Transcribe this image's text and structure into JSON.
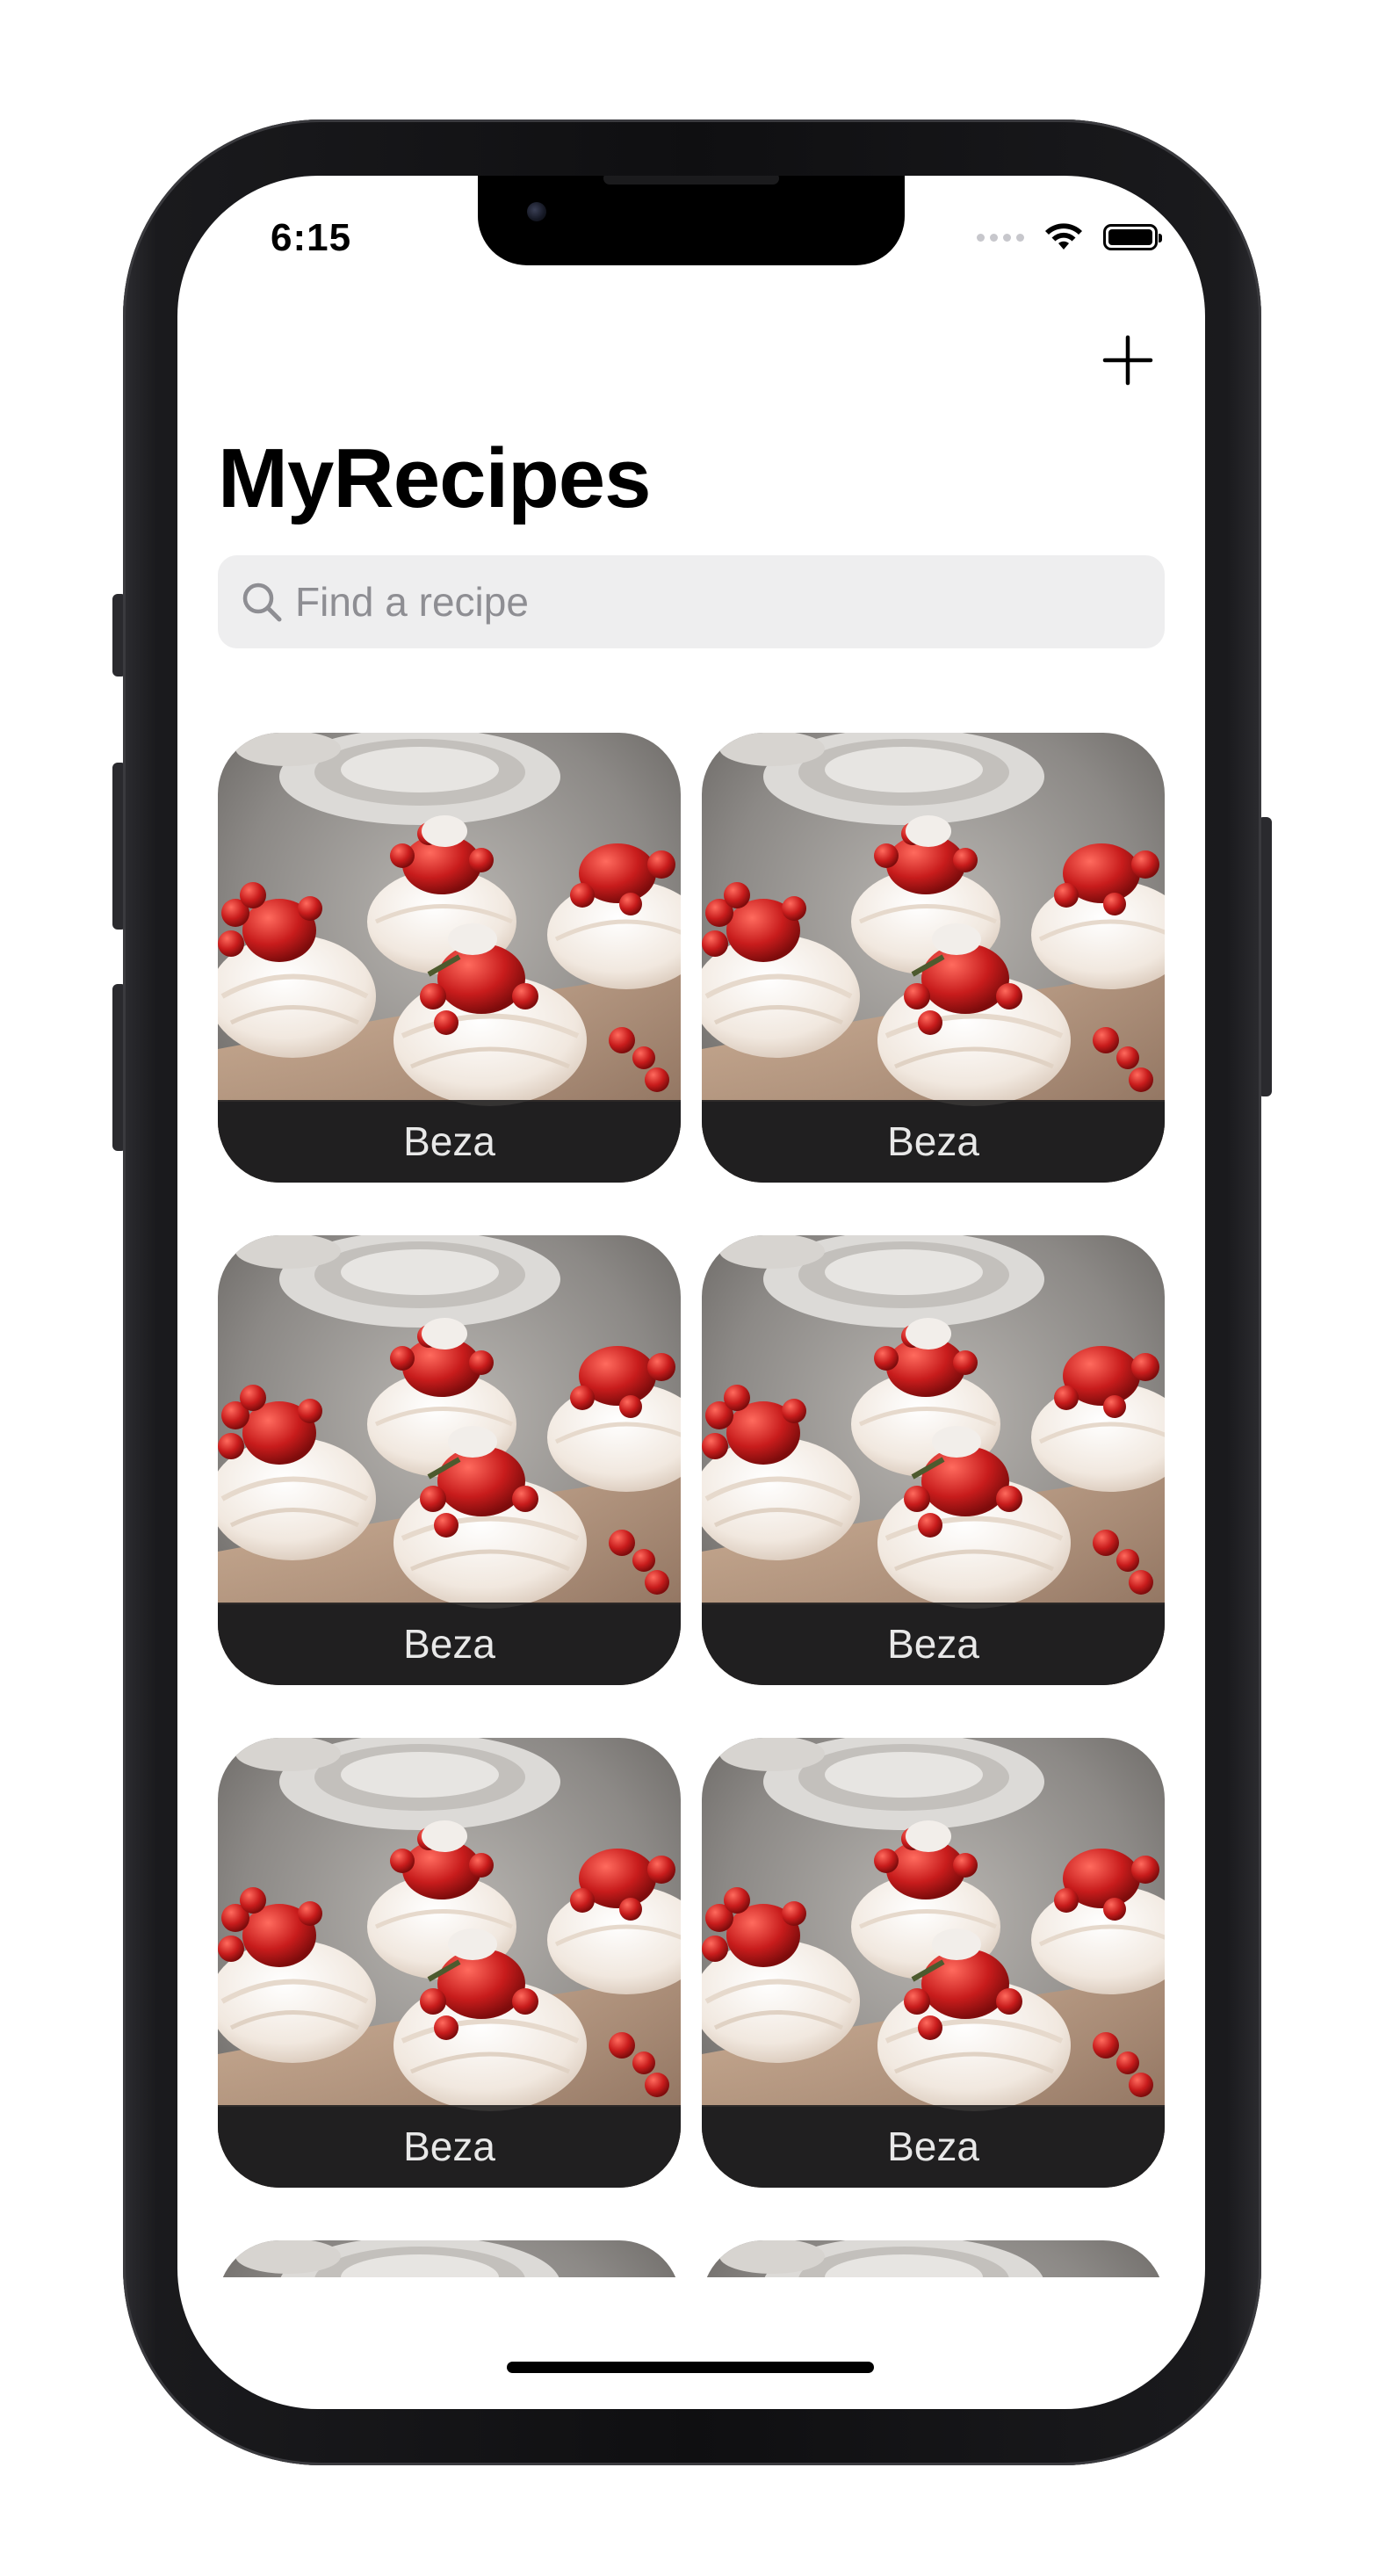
{
  "status_bar": {
    "time": "6:15"
  },
  "header": {
    "add_icon": "plus-icon",
    "title": "MyRecipes"
  },
  "search": {
    "icon": "search-icon",
    "placeholder": "Find a recipe",
    "value": ""
  },
  "recipes": [
    {
      "name": "Beza"
    },
    {
      "name": "Beza"
    },
    {
      "name": "Beza"
    },
    {
      "name": "Beza"
    },
    {
      "name": "Beza"
    },
    {
      "name": "Beza"
    },
    {
      "name": ""
    },
    {
      "name": ""
    }
  ],
  "colors": {
    "accent": "#000000",
    "caption_background": "#1c1c1e",
    "search_background": "#eeeeef",
    "placeholder": "#8e8e93"
  }
}
